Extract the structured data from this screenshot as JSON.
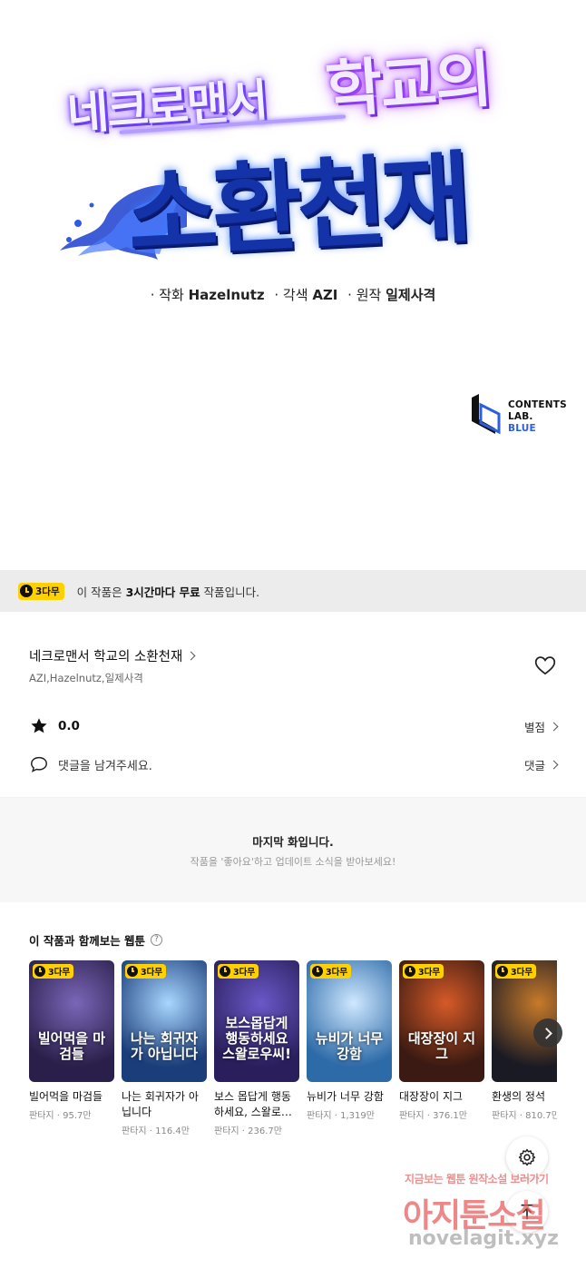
{
  "hero": {
    "title_part1": "네크로맨서",
    "title_part2": "학교의",
    "title_part3": "소환천재",
    "credits": [
      {
        "label": "· 작화",
        "value": "Hazelnutz"
      },
      {
        "label": "· 각색",
        "value": "AZI"
      },
      {
        "label": "· 원작",
        "value": "일제사격"
      }
    ],
    "publisher_line1": "CONTENTS",
    "publisher_line2": "LAB.",
    "publisher_line3": "BLUE"
  },
  "notice": {
    "badge": "3다무",
    "text_prefix": "이 작품은 ",
    "text_bold": "3시간마다 무료",
    "text_suffix": " 작품입니다."
  },
  "work": {
    "title": "네크로맨서 학교의 소환천재",
    "authors": "AZI,Hazelnutz,일제사격",
    "rating": "0.0",
    "rating_link": "별점",
    "comment_placeholder": "댓글을 남겨주세요.",
    "comment_link": "댓글"
  },
  "last_episode": {
    "title": "마지막 화입니다.",
    "subtitle": "작품을 '좋아요'하고 업데이트 소식을 받아보세요!"
  },
  "recommendations": {
    "heading": "이 작품과 함께보는 웹툰",
    "help_icon": "?",
    "items": [
      {
        "badge": "3다무",
        "title": "빌어먹을 마검들",
        "meta": "판타지 · 95.7만",
        "cover_text": "빌어먹을 마검들",
        "color1": "#2a1f4a",
        "color2": "#7a66b8"
      },
      {
        "badge": "3다무",
        "title": "나는 회귀자가 아닙니다",
        "meta": "판타지 · 116.4만",
        "cover_text": "나는 회귀자가 아닙니다",
        "color1": "#1b3d7a",
        "color2": "#a8d6ff"
      },
      {
        "badge": "3다무",
        "title": "보스 몹답게 행동하세요, 스왈로…",
        "meta": "판타지 · 236.7만",
        "cover_text": "보스몹답게 행동하세요 스왈로우씨!",
        "color1": "#2a1f5c",
        "color2": "#6a58c8"
      },
      {
        "badge": "3다무",
        "title": "뉴비가 너무 강함",
        "meta": "판타지 · 1,319만",
        "cover_text": "뉴비가 너무강함",
        "color1": "#2c6aa8",
        "color2": "#cfe8ff"
      },
      {
        "badge": "3다무",
        "title": "대장장이 지그",
        "meta": "판타지 · 376.1만",
        "cover_text": "대장장이 지그",
        "color1": "#3a1a12",
        "color2": "#d65a28"
      },
      {
        "badge": "3다무",
        "title": "환생의 정석",
        "meta": "판타지 · 810.7만",
        "cover_text": "",
        "color1": "#1a1a24",
        "color2": "#c87a2a"
      }
    ]
  },
  "watermark": {
    "top": "지금보는 웹툰 원작소설 보러가기",
    "main": "아지툰소설",
    "url": "novelagit.xyz"
  }
}
